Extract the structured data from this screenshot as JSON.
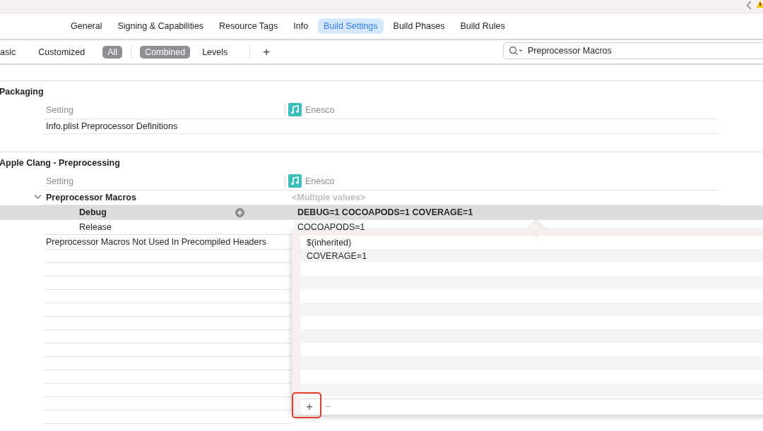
{
  "tabs": [
    {
      "label": "General",
      "selected": false
    },
    {
      "label": "Signing & Capabilities",
      "selected": false
    },
    {
      "label": "Resource Tags",
      "selected": false
    },
    {
      "label": "Info",
      "selected": false
    },
    {
      "label": "Build Settings",
      "selected": true
    },
    {
      "label": "Build Phases",
      "selected": false
    },
    {
      "label": "Build Rules",
      "selected": false
    }
  ],
  "scope_filters": [
    {
      "label": "asic",
      "selected": false
    },
    {
      "label": "Customized",
      "selected": false
    },
    {
      "label": "All",
      "selected": true
    }
  ],
  "view_filters": [
    {
      "label": "Combined",
      "selected": true
    },
    {
      "label": "Levels",
      "selected": false
    }
  ],
  "add_button": "+",
  "search": {
    "value": "Preprocessor Macros"
  },
  "sections": [
    {
      "title": "Packaging",
      "header": {
        "setting": "Setting",
        "target": "Enesco"
      },
      "rows": [
        {
          "name": "Info.plist Preprocessor Definitions"
        }
      ]
    },
    {
      "title": "Apple Clang - Preprocessing",
      "header": {
        "setting": "Setting",
        "target": "Enesco"
      },
      "rows": [
        {
          "name": "Preprocessor Macros",
          "expanded": true,
          "value": "<Multiple values>",
          "children": [
            {
              "name": "Debug",
              "value": "DEBUG=1  COCOAPODS=1 COVERAGE=1",
              "selected": true
            },
            {
              "name": "Release",
              "value": "COCOAPODS=1",
              "selected": false
            }
          ]
        },
        {
          "name": "Preprocessor Macros Not Used In Precompiled Headers"
        }
      ]
    }
  ],
  "popover": {
    "items": [
      "$(inherited)",
      "COVERAGE=1"
    ],
    "add": "+",
    "remove": "−",
    "add_highlighted": true
  }
}
